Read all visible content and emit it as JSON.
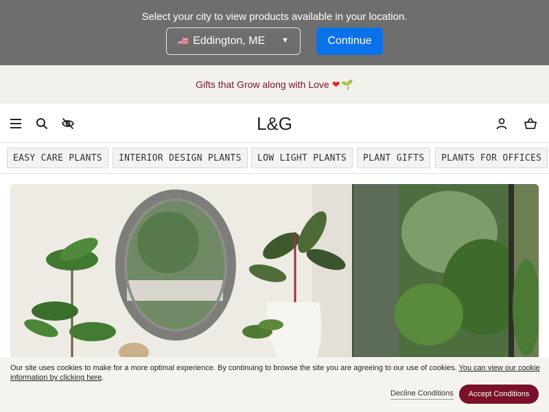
{
  "location_bar": {
    "message": "Select your city to view products available in your location.",
    "city_flag": "🇺🇸",
    "city_value": "Eddington, ME",
    "continue_label": "Continue"
  },
  "promo": {
    "text": "Gifts that Grow along with Love",
    "heart": "❤",
    "sprout": "🌱"
  },
  "header": {
    "logo": "L&G",
    "icons": [
      "menu-icon",
      "search-icon",
      "eye-off-icon",
      "account-icon",
      "basket-icon"
    ]
  },
  "categories": [
    "EASY CARE PLANTS",
    "INTERIOR DESIGN PLANTS",
    "LOW LIGHT PLANTS",
    "PLANT GIFTS",
    "PLANTS FOR OFFICES"
  ],
  "cookie": {
    "text": "Our site uses cookies to make for a more optimal experience. By continuing to browse the site you are agreeing to our use of cookies.",
    "link": "You can view our cookie information by clicking here",
    "link_suffix": ".",
    "decline_label": "Decline Conditions",
    "accept_label": "Accept Conditions"
  },
  "colors": {
    "location_bar_bg": "#6e6e6e",
    "continue_bg": "#0a72e8",
    "promo_bg": "#f3f1ec",
    "promo_text": "#7b1425",
    "accept_bg": "#7a1129"
  }
}
